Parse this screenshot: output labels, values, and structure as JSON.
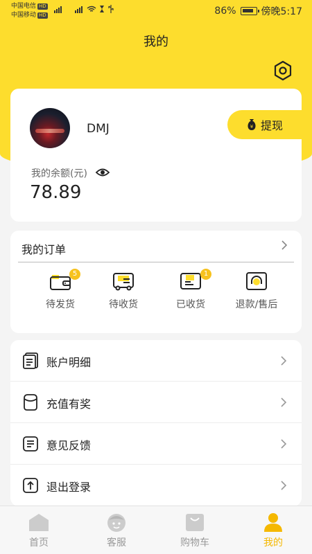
{
  "status_bar": {
    "carrier1": "中国电信",
    "carrier2": "中国移动",
    "hd": "HD",
    "battery_percent": "86%",
    "time": "傍晚5:17"
  },
  "header": {
    "title": "我的"
  },
  "profile": {
    "username": "DMJ",
    "withdraw_label": "提现",
    "balance_label": "我的余额(元)",
    "balance_value": "78.89"
  },
  "orders": {
    "title": "我的订单",
    "items": [
      {
        "label": "待发货",
        "badge": "5",
        "icon": "wallet-icon"
      },
      {
        "label": "待收货",
        "badge": "",
        "icon": "truck-icon"
      },
      {
        "label": "已收货",
        "badge": "1",
        "icon": "card-icon"
      },
      {
        "label": "退款/售后",
        "badge": "",
        "icon": "headset-icon"
      }
    ]
  },
  "menu": {
    "items": [
      {
        "label": "账户明细",
        "icon": "document-icon"
      },
      {
        "label": "充值有奖",
        "icon": "gift-bag-icon"
      },
      {
        "label": "意见反馈",
        "icon": "feedback-icon"
      },
      {
        "label": "退出登录",
        "icon": "logout-icon"
      }
    ]
  },
  "bottom_nav": {
    "items": [
      {
        "label": "首页",
        "icon": "home-icon",
        "active": false
      },
      {
        "label": "客服",
        "icon": "service-icon",
        "active": false
      },
      {
        "label": "购物车",
        "icon": "cart-icon",
        "active": false
      },
      {
        "label": "我的",
        "icon": "profile-icon",
        "active": true
      }
    ]
  },
  "colors": {
    "accent": "#fddd2d",
    "badge": "#f7c21e",
    "active_tab": "#f5b800",
    "inactive_icon": "#cccccc"
  }
}
